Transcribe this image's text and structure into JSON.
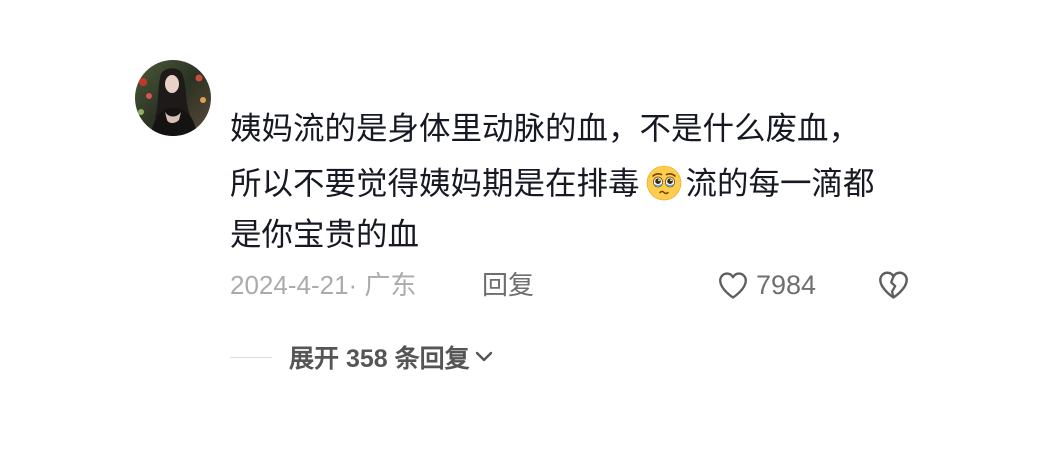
{
  "comment": {
    "avatar_icon": "user-avatar",
    "line1": "姨妈流的是身体里动脉的血，不是什么废血，",
    "line2_before_emoji": "所以不要觉得姨妈期是在排毒",
    "emoji_icon": "face-holding-back-tears-icon",
    "line2_after_emoji": "流的每一滴都",
    "line3": "是你宝贵的血"
  },
  "meta": {
    "date_location": "2024-4-21· 广东",
    "reply_label": "回复",
    "like_icon": "heart-outline-icon",
    "like_count": "7984",
    "dislike_icon": "broken-heart-icon"
  },
  "replies": {
    "expand_label": "展开 358 条回复",
    "chevron_icon": "chevron-down-icon"
  },
  "colors": {
    "text": "#161823",
    "meta": "#ababab",
    "action": "#6e6e6e",
    "background": "#ffffff"
  }
}
